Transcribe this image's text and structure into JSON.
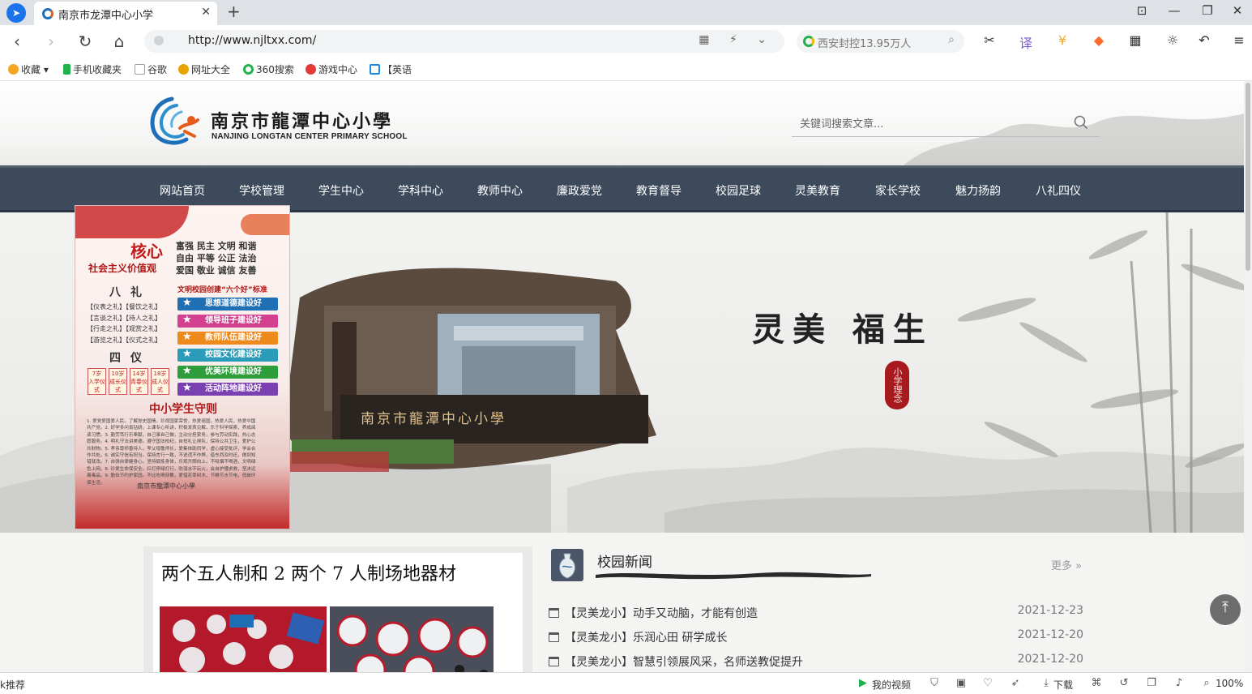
{
  "browser": {
    "tab": {
      "title": "南京市龙潭中心小学",
      "close": "✕"
    },
    "new_tab": "+",
    "window_controls": {
      "skin": "⊡",
      "minimize": "—",
      "restore": "❐",
      "close": "✕"
    },
    "nav": {
      "back": "‹",
      "forward": "›",
      "reload": "↻",
      "home": "⌂"
    },
    "url": "http://www.njltxx.com/",
    "url_icons": "▦ ⚡ ⌄",
    "search": {
      "placeholder": "西安封控13.95万人",
      "icon": "search-icon"
    },
    "toolbar_icons": [
      "scissors-icon",
      "translate-icon",
      "coin-icon",
      "game-icon",
      "apps-icon",
      "brightness-icon",
      "undo-icon",
      "menu-icon"
    ],
    "bookmarks": [
      {
        "label": "收藏",
        "icon": "star-icon",
        "color": "#f5a623"
      },
      {
        "label": "手机收藏夹",
        "icon": "phone-icon",
        "color": "#22b14c"
      },
      {
        "label": "谷歌",
        "icon": "page-icon",
        "color": "#9e9e9e"
      },
      {
        "label": "网址大全",
        "icon": "globe-icon",
        "color": "#e8a400"
      },
      {
        "label": "360搜索",
        "icon": "search360-icon",
        "color": "#22b14c"
      },
      {
        "label": "游戏中心",
        "icon": "game-center-icon",
        "color": "#e53935"
      },
      {
        "label": "【英语",
        "icon": "bilibili-icon",
        "color": "#1e88e5"
      }
    ]
  },
  "site": {
    "name_cn": "南京市龍潭中心小學",
    "name_en": "NANJING LONGTAN CENTER PRIMARY SCHOOL",
    "search_placeholder": "关键词搜索文章...",
    "nav": [
      "网站首页",
      "学校管理",
      "学生中心",
      "学科中心",
      "教师中心",
      "廉政爱党",
      "教育督导",
      "校园足球",
      "灵美教育",
      "家长学校",
      "魅力扬韵",
      "八礼四仪"
    ],
    "banner": {
      "slogan": "灵美 福生",
      "seal": "小学理念",
      "gate_sign": "南京市龍潭中心小學"
    },
    "poster": {
      "core": "核心",
      "core_sub": "社会主义价值观",
      "values": [
        "富强 民主 文明 和谐",
        "自由 平等 公正 法治",
        "爱国 敬业 诚信 友善"
      ],
      "bali_title": "八礼",
      "li_items": [
        "【仪表之礼】【餐饮之礼】",
        "【言谈之礼】【待人之礼】",
        "【行走之礼】【观赏之礼】",
        "【游览之礼】【仪式之礼】"
      ],
      "siyi_title": "四仪",
      "ages": [
        {
          "age": "7岁",
          "name": "入学仪式"
        },
        {
          "age": "10岁",
          "name": "成长仪式"
        },
        {
          "age": "14岁",
          "name": "青春仪式"
        },
        {
          "age": "18岁",
          "name": "成人仪式"
        }
      ],
      "standard": "文明校园创建“六个好”标准",
      "bars": [
        {
          "label": "思想道德建设好",
          "color": "#1f6fb5"
        },
        {
          "label": "领导班子建设好",
          "color": "#d2408f"
        },
        {
          "label": "教师队伍建设好",
          "color": "#ee8a1c"
        },
        {
          "label": "校园文化建设好",
          "color": "#2a9bb8"
        },
        {
          "label": "优美环境建设好",
          "color": "#2e9e3d"
        },
        {
          "label": "活动阵地建设好",
          "color": "#7a3fb0"
        }
      ],
      "rules_title": "中小学生守则",
      "rules": "1. 爱党爱国爱人民。了解党史国情，珍视国家荣誉，热爱祖国，热爱人民，热爱中国共产党。2. 好学多问肯钻研。上课专心听讲，积极发表见解，乐于科学探索，养成阅读习惯。3. 勤劳笃行乐奉献。自己事自己做，主动分担家务，参与劳动实践，热心志愿服务。4. 明礼守法讲美德。遵守国法校纪，自觉礼让排队，保持公共卫生，爱护公共财物。5. 孝亲尊师善待人。孝父母敬师长，爱集体助同学，虚心接受批评，学会合作共处。6. 诚实守信有担当。保持言行一致，不说谎不作弊，借东西及时还，做到知错就改。7. 自强自律健身心。坚持锻炼身体，乐观开朗向上，不吸烟不喝酒，文明绿色上网。8. 珍爱生命保安全。红灯停绿灯行，防溺水不玩火，会自护懂求救，坚决远离毒品。9. 勤俭节约护家园。不比吃喝穿戴，爱惜花草树木，节粮节水节电，低碳环保生活。",
      "footer": "南京市龍潭中心小學"
    },
    "card": {
      "title": "两个五人制和 2 两个 7 人制场地器材"
    },
    "news": {
      "title": "校园新闻",
      "more": "更多 »",
      "items": [
        {
          "text": "【灵美龙小】动手又动脑，才能有创造",
          "date": "2021-12-23"
        },
        {
          "text": "【灵美龙小】乐润心田 研学成长",
          "date": "2021-12-20"
        },
        {
          "text": "【灵美龙小】智慧引领展风采，名师送教促提升",
          "date": "2021-12-20"
        }
      ]
    },
    "back_to_top": "⤒"
  },
  "statusbar": {
    "left": "k推荐",
    "video": "我的视频",
    "download": "下载",
    "zoom": "100%"
  },
  "colors": {
    "nav_bg": "#3c4a5c",
    "accent_red": "#a8191d",
    "logo_blue": "#1e6fb8",
    "logo_orange": "#e65c1b"
  }
}
